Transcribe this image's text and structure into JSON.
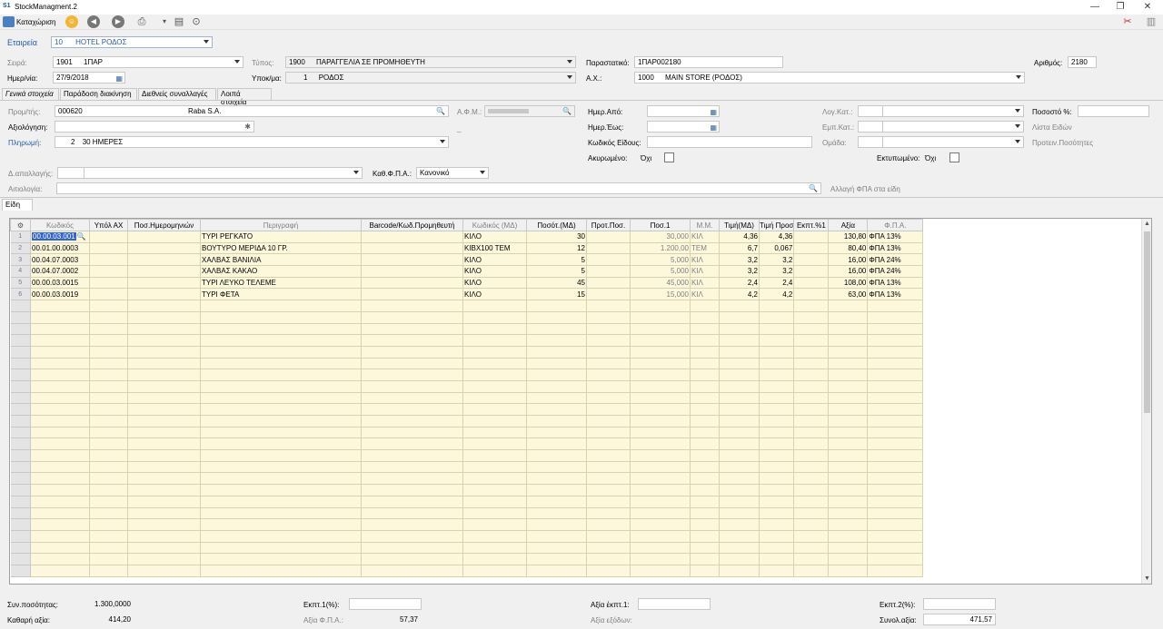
{
  "window": {
    "title": "StockManagment.2"
  },
  "toolbar": {
    "register_label": "Καταχώριση"
  },
  "company": {
    "label": "Εταιρεία",
    "code": "10",
    "name": "HOTEL ΡΟΔΟΣ"
  },
  "header": {
    "series_label": "Σειρά:",
    "series_code": "1901",
    "series_name": "1ΠΑΡ",
    "type_label": "Τύπος:",
    "type_code": "1900",
    "type_name": "ΠΑΡΑΓΓΕΛΙΑ ΣΕ ΠΡΟΜΗΘΕΥΤΗ",
    "doc_label": "Παραστατικό:",
    "doc_value": "1ΠΑΡ002180",
    "number_label": "Αριθμός:",
    "number_value": "2180",
    "date_label": "Ημερ/νία:",
    "date_value": "27/9/2018",
    "branch_label": "Υποκ/μα:",
    "branch_code": "1",
    "branch_name": "ΡΟΔΟΣ",
    "warehouse_label": "Α.Χ.:",
    "warehouse_code": "1000",
    "warehouse_name": "MAIN STORE (ΡΟΔΟΣ)"
  },
  "tabs": [
    "Γενικά στοιχεία",
    "Παράδοση διακίνηση",
    "Διεθνείς συναλλαγές",
    "Λοιπά στοιχεία"
  ],
  "general": {
    "supplier_label": "Προμ/τής:",
    "supplier_code": "000620",
    "supplier_name": "Raba S.A.",
    "afm_label": "Α.Φ.Μ.:",
    "afm_value": "",
    "rating_label": "Αξιολόγηση:",
    "payment_label": "Πληρωμή:",
    "payment_code": "2",
    "payment_name": "30 ΗΜΕΡΕΣ",
    "exempt_label": "Δ.απαλλαγής:",
    "vat_label": "Καθ.Φ.Π.Α.:",
    "vat_value": "Κανονικό",
    "reason_label": "Αιτιολογία:",
    "date_from_label": "Ημερ.Από:",
    "date_to_label": "Ημερ.Έως:",
    "item_code_label": "Κωδικός Είδους:",
    "cancelled_label": "Ακυρωμένο:",
    "cancelled_value": "Όχι",
    "account_cat_label": "Λογ.Κατ.:",
    "commercial_cat_label": "Εμπ.Κατ.:",
    "group_label": "Ομάδα:",
    "printed_label": "Εκτυπωμένο:",
    "printed_value": "Όχι",
    "percent_label": "Ποσοστό %:",
    "item_list_label": "Λίστα Ειδών",
    "suggested_qty_label": "Προτειν.Ποσότητες",
    "change_vat_label": "Αλλαγή ΦΠΑ στα είδη",
    "dash": "_"
  },
  "items_tab": "Είδη",
  "grid": {
    "columns": [
      "Κωδικός",
      "Υπόλ ΑΧ",
      "Ποσ.Ημερομηνιών",
      "Περιγραφή",
      "Barcode/Κωδ.Προμηθευτή",
      "Κωδικός (ΜΔ)",
      "Ποσότ.(ΜΔ)",
      "Προτ.Ποσ.",
      "Ποσ.1",
      "Μ.Μ.",
      "Τιμή(ΜΔ)",
      "Τιμή Προσ",
      "Εκπτ.%1",
      "Αξία",
      "Φ.Π.Α."
    ],
    "rows": [
      {
        "n": "1",
        "code": "00.00.03.001",
        "desc": "ΤΥΡΙ ΡΕΓΚΑΤΟ",
        "unit_md": "ΚΙΛΟ",
        "qty": "30",
        "qty1": "30,000",
        "mm": "ΚΙΛ",
        "price": "4,36",
        "price2": "4,36",
        "value": "130,80",
        "vat": "ΦΠΑ 13%"
      },
      {
        "n": "2",
        "code": "00.01.00.0003",
        "desc": "ΒΟΥΤΥΡΟ ΜΕΡΙΔΑ 10 ΓΡ.",
        "unit_md": "ΚΙΒΧ100 ΤΕΜ",
        "qty": "12",
        "qty1": "1.200,00",
        "mm": "ΤΕΜ",
        "price": "6,7",
        "price2": "0,067",
        "value": "80,40",
        "vat": "ΦΠΑ 13%"
      },
      {
        "n": "3",
        "code": "00.04.07.0003",
        "desc": "ΧΑΛΒΑΣ ΒΑΝΙΛΙΑ",
        "unit_md": "ΚΙΛΟ",
        "qty": "5",
        "qty1": "5,000",
        "mm": "ΚΙΛ",
        "price": "3,2",
        "price2": "3,2",
        "value": "16,00",
        "vat": "ΦΠΑ 24%"
      },
      {
        "n": "4",
        "code": "00.04.07.0002",
        "desc": "ΧΑΛΒΑΣ ΚΑΚΑΟ",
        "unit_md": "ΚΙΛΟ",
        "qty": "5",
        "qty1": "5,000",
        "mm": "ΚΙΛ",
        "price": "3,2",
        "price2": "3,2",
        "value": "16,00",
        "vat": "ΦΠΑ 24%"
      },
      {
        "n": "5",
        "code": "00.00.03.0015",
        "desc": "ΤΥΡΙ ΛΕΥΚΟ ΤΕΛΕΜΕ",
        "unit_md": "ΚΙΛΟ",
        "qty": "45",
        "qty1": "45,000",
        "mm": "ΚΙΛ",
        "price": "2,4",
        "price2": "2,4",
        "value": "108,00",
        "vat": "ΦΠΑ 13%"
      },
      {
        "n": "6",
        "code": "00.00.03.0019",
        "desc": "ΤΥΡΙ ΦΕΤΑ",
        "unit_md": "ΚΙΛΟ",
        "qty": "15",
        "qty1": "15,000",
        "mm": "ΚΙΛ",
        "price": "4,2",
        "price2": "4,2",
        "value": "63,00",
        "vat": "ΦΠΑ 13%"
      }
    ]
  },
  "footer": {
    "total_qty_label": "Συν.ποσότητας:",
    "total_qty": "1.300,0000",
    "net_label": "Καθαρή αξία:",
    "net_value": "414,20",
    "disc1_label": "Εκπτ.1(%):",
    "vat_amount_label": "Αξία Φ.Π.Α.:",
    "vat_amount": "57,37",
    "disc1_value_label": "Αξία έκπτ.1:",
    "expenses_label": "Αξία εξόδων:",
    "disc2_label": "Εκπτ.2(%):",
    "total_label": "Συνολ.αξία:",
    "total_value": "471,57"
  }
}
